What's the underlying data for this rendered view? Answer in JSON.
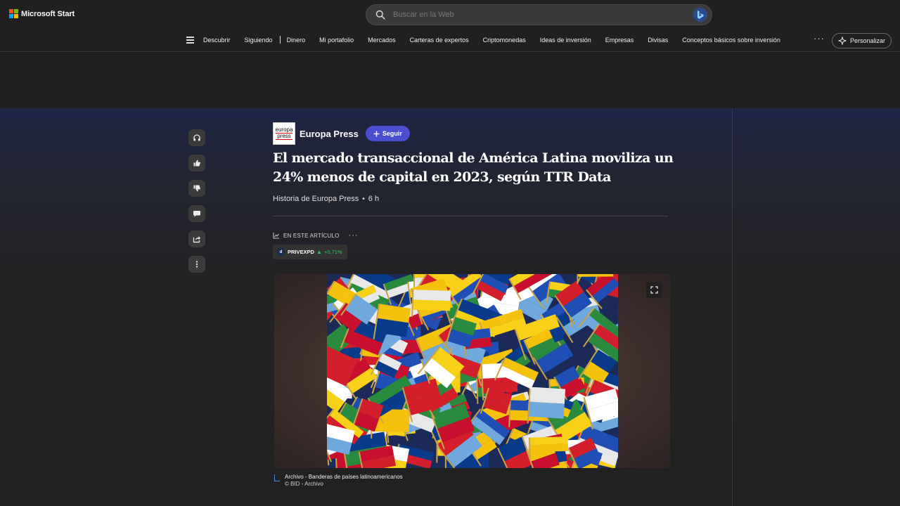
{
  "app": {
    "brand": "Microsoft Start"
  },
  "search": {
    "placeholder": "Buscar en la Web"
  },
  "nav": {
    "items": [
      "Descubrir",
      "Siguiendo",
      "Dinero",
      "Mi portafolio",
      "Mercados",
      "Carteras de expertos",
      "Criptomonedas",
      "Ideas de inversión",
      "Empresas",
      "Divisas",
      "Conceptos básicos sobre inversión"
    ],
    "more": "···",
    "personalize": "Personalizar"
  },
  "article": {
    "publisher": "Europa Press",
    "publisher_logo_line1": "europa",
    "publisher_logo_line2": "press",
    "follow_label": "Seguir",
    "headline": "El mercado transaccional de América Latina moviliza un 24% menos de capital en 2023, según TTR Data",
    "byline": "Historia de Europa Press",
    "age": "6 h",
    "in_article_label": "EN ESTE ARTÍCULO",
    "ticker": {
      "symbol": "PRIVEXPD",
      "change": "+0,71%",
      "direction": "up"
    },
    "caption": {
      "title": "Archivo - Banderas de países latinoamericanos",
      "credit": "© BID - Archivo"
    }
  },
  "rail": {
    "icons": [
      "headphones-icon",
      "thumbs-up-icon",
      "thumbs-down-icon",
      "comment-icon",
      "share-icon",
      "more-vertical-icon"
    ]
  },
  "colors": {
    "follow": "#4a4fd1",
    "positive": "#3cc46a",
    "caption_accent": "#4a8ae0"
  }
}
